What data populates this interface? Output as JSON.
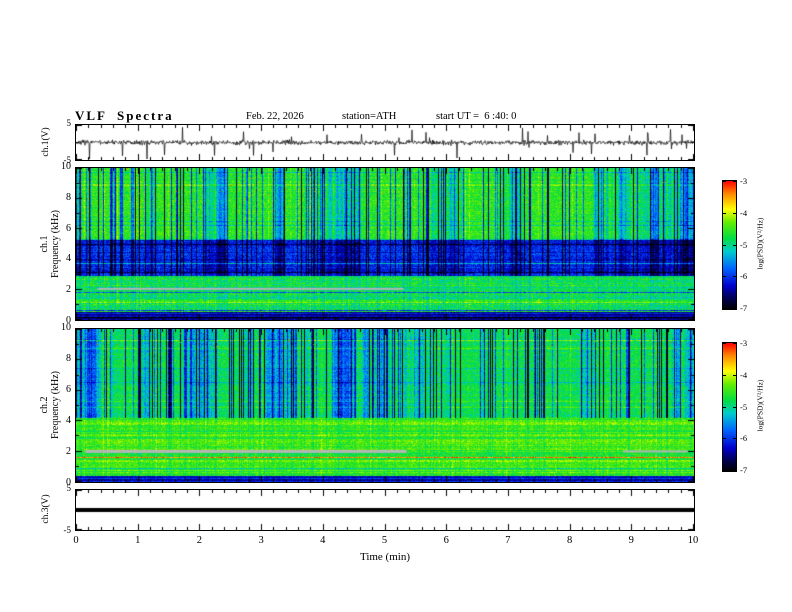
{
  "header": {
    "title": "VLF  Spectra",
    "date": "Feb. 22, 2026",
    "station": "station=ATH",
    "start_ut": "start UT =  6 :40: 0"
  },
  "axes": {
    "x": {
      "label": "Time  (min)",
      "range": [
        0,
        10
      ],
      "ticks": [
        0,
        1,
        2,
        3,
        4,
        5,
        6,
        7,
        8,
        9,
        10
      ],
      "minor_step": 0.2
    }
  },
  "colormap": {
    "label": "log(PSD)(V²/Hz)",
    "ticks": [
      -3,
      -4,
      -5,
      -6,
      -7
    ],
    "zlim": [
      -7,
      -3
    ],
    "stops": [
      [
        0.0,
        "#000000"
      ],
      [
        0.08,
        "#00004d"
      ],
      [
        0.18,
        "#0000cc"
      ],
      [
        0.32,
        "#0066ff"
      ],
      [
        0.45,
        "#00cccc"
      ],
      [
        0.55,
        "#00dd44"
      ],
      [
        0.68,
        "#66ee00"
      ],
      [
        0.78,
        "#ffff00"
      ],
      [
        0.9,
        "#ff8800"
      ],
      [
        1.0,
        "#ff0000"
      ]
    ]
  },
  "chart_data": [
    {
      "panel": "ch1-waveform",
      "type": "line",
      "ylabel": "ch.1(V)",
      "ylim": [
        -5,
        5
      ],
      "yticks_major": [
        5,
        -5
      ],
      "yticks_minor": [
        0
      ],
      "seed": 7,
      "noise_sigma_v": 0.5,
      "spike_probability": 0.03,
      "spike_max_v": 5,
      "note": "broadband VLF voltage time series, dense noise around 0 V with impulsive sferic spikes reaching about plus/minus 5 V"
    },
    {
      "panel": "ch1-spectrogram",
      "type": "heatmap",
      "ylabel_line1": "ch.1",
      "ylabel_line2": "Frequency  (kHz)",
      "ylim": [
        0,
        10
      ],
      "yticks_major": [
        0,
        2,
        4,
        6,
        8,
        10
      ],
      "yticks_minor": [
        1,
        3,
        5,
        7,
        9
      ],
      "zlim": [
        -7,
        -3
      ],
      "seed": 101,
      "bands": [
        {
          "f0": 0.0,
          "f1": 0.55,
          "base": -6.2,
          "stripe": 1.7,
          "noise": 0.5,
          "streak": 0.05,
          "bright": 0.0
        },
        {
          "f0": 0.55,
          "f1": 2.9,
          "base": -4.75,
          "stripe": 1.0,
          "noise": 0.7,
          "streak": 0.15,
          "bright": 0.3
        },
        {
          "f0": 2.9,
          "f1": 5.3,
          "base": -6.05,
          "stripe": 0.7,
          "noise": 0.6,
          "streak": 0.55,
          "bright": 0.1
        },
        {
          "f0": 5.3,
          "f1": 10.01,
          "base": -4.55,
          "stripe": 0.4,
          "noise": 0.6,
          "streak": 1.0,
          "bright": 0.45
        }
      ],
      "speck_f_min": 8.2,
      "speck_probability": 0.0035,
      "gray_lines": [
        {
          "t0": 0.35,
          "t1": 5.3,
          "f": 2.05,
          "h": 2
        }
      ],
      "note": "green-yellow background above 5 kHz cut by dark-blue vertical sferic streaks; dark blue band 3-5 kHz; green banded region below 3 kHz; dark striped rows below 0.5 kHz"
    },
    {
      "panel": "ch2-spectrogram",
      "type": "heatmap",
      "ylabel_line1": "ch.2",
      "ylabel_line2": "Frequency  (kHz)",
      "ylim": [
        0,
        10
      ],
      "yticks_major": [
        0,
        2,
        4,
        6,
        8,
        10
      ],
      "yticks_minor": [
        1,
        3,
        5,
        7,
        9
      ],
      "zlim": [
        -7,
        -3
      ],
      "seed": 202,
      "bands": [
        {
          "f0": 0.0,
          "f1": 0.45,
          "base": -6.0,
          "stripe": 1.6,
          "noise": 0.5,
          "streak": 0.05,
          "bright": 0.0
        },
        {
          "f0": 0.45,
          "f1": 4.2,
          "base": -4.45,
          "stripe": 1.05,
          "noise": 0.55,
          "streak": 0.12,
          "bright": 0.25
        },
        {
          "f0": 4.2,
          "f1": 10.01,
          "base": -4.8,
          "stripe": 0.45,
          "noise": 0.6,
          "streak": 1.0,
          "bright": 0.35
        }
      ],
      "speck_f_min": 8.5,
      "speck_probability": 0.002,
      "gray_lines": [
        {
          "t0": 0.15,
          "t1": 5.35,
          "f": 2.0,
          "h": 3
        },
        {
          "t0": 8.85,
          "t1": 9.9,
          "f": 2.0,
          "h": 2
        }
      ],
      "note": "yellow-green strongly row-striped region below 4 kHz with gray interference segments near 2 kHz; green region above 4 kHz cut by dark-blue vertical streaks"
    },
    {
      "panel": "ch3-waveform",
      "type": "line",
      "ylabel": "ch.3(V)",
      "ylim": [
        -5,
        5
      ],
      "yticks_major": [
        5,
        -5
      ],
      "yticks_minor": [
        0
      ],
      "value": 0,
      "note": "flat thick black trace at 0 V for entire record"
    }
  ]
}
